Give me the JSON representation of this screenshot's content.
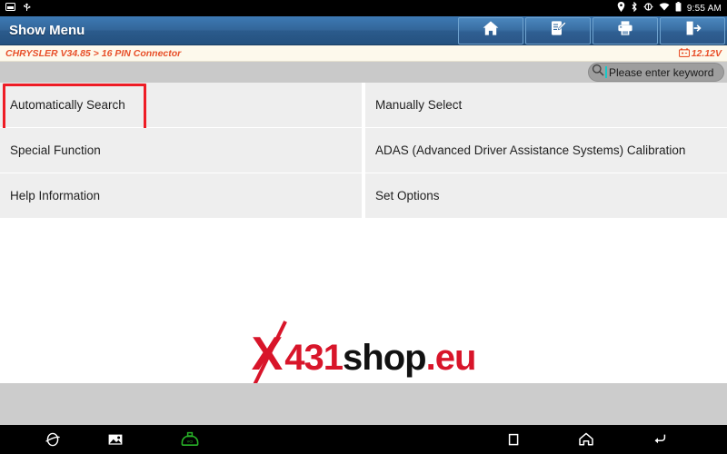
{
  "statusbar": {
    "icons_left": [
      "screenshot-icon",
      "usb-icon"
    ],
    "icons_right": [
      "location-icon",
      "bluetooth-icon",
      "sync-icon",
      "wifi-icon",
      "battery-icon"
    ],
    "time": "9:55 AM"
  },
  "titlebar": {
    "title": "Show Menu",
    "buttons": [
      {
        "name": "home-button",
        "icon": "home-icon"
      },
      {
        "name": "notes-button",
        "icon": "edit-note-icon"
      },
      {
        "name": "print-button",
        "icon": "printer-icon"
      },
      {
        "name": "exit-button",
        "icon": "exit-icon"
      }
    ]
  },
  "breadcrumb": {
    "path": "CHRYSLER V34.85 > 16 PIN Connector",
    "voltage": "12.12V",
    "voltage_icon": "car-battery-icon"
  },
  "search": {
    "placeholder": "Please enter keyword",
    "icon": "search-icon",
    "value": ""
  },
  "menu": {
    "left_column": [
      {
        "label": "Automatically Search",
        "highlighted": true
      },
      {
        "label": "Special Function",
        "highlighted": false
      },
      {
        "label": "Help Information",
        "highlighted": false
      }
    ],
    "right_column": [
      {
        "label": "Manually Select",
        "highlighted": false
      },
      {
        "label": "ADAS (Advanced Driver Assistance Systems) Calibration",
        "highlighted": false
      },
      {
        "label": "Set Options",
        "highlighted": false
      }
    ]
  },
  "watermark": {
    "x": "X",
    "num": "431",
    "shop": "shop",
    "tld": ".eu"
  },
  "navbar": {
    "items": [
      {
        "name": "browser-icon"
      },
      {
        "name": "gallery-icon"
      },
      {
        "name": "obd-connector-icon"
      },
      {
        "name": "recents-icon"
      },
      {
        "name": "home-icon"
      },
      {
        "name": "back-icon"
      }
    ]
  },
  "colors": {
    "title_blue": "#336699",
    "accent_red": "#e8502a",
    "highlight_red": "#ee1c25",
    "cell_grey": "#eeeeee",
    "band_grey": "#cccccc",
    "breadcrumb_bg": "#fdf9ec"
  }
}
